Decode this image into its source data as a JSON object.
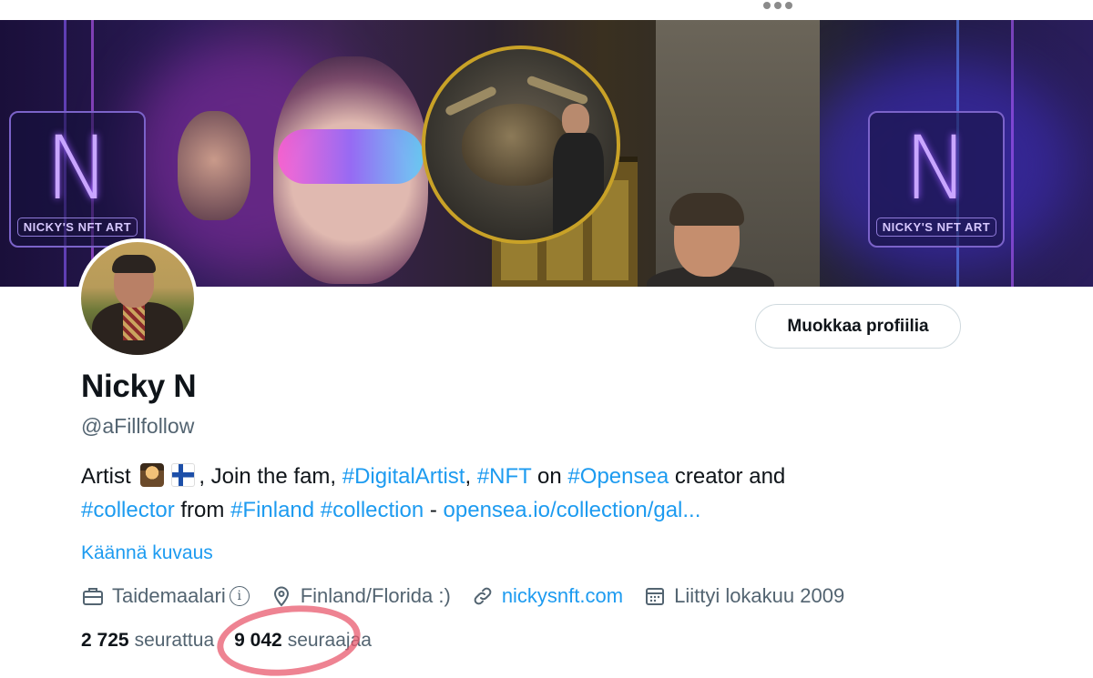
{
  "banner": {
    "logo_letter": "N",
    "logo_caption": "NICKY'S NFT ART"
  },
  "profile": {
    "name": "Nicky N",
    "handle": "@aFillfollow",
    "edit_button_label": "Muokkaa profiilia"
  },
  "bio": {
    "t1": "Artist ",
    "t2": ", Join the fam, ",
    "tag1": "#DigitalArtist",
    "t3": ", ",
    "tag2": "#NFT",
    "t4": " on ",
    "tag3": "#Opensea",
    "t5": " creator and ",
    "tag4": "#collector",
    "t6": " from ",
    "tag5": "#Finland",
    "t7": " ",
    "tag6": "#collection",
    "t8": " - ",
    "link": "opensea.io/collection/gal..."
  },
  "translate_label": "Käännä kuvaus",
  "meta": {
    "category": "Taidemaalari",
    "info_glyph": "i",
    "location": "Finland/Florida :)",
    "website": "nickysnft.com",
    "joined": "Liittyi lokakuu 2009"
  },
  "stats": {
    "following_count": "2 725",
    "following_label": "seurattua",
    "followers_count": "9 042",
    "followers_label": "seuraajaa"
  },
  "colors": {
    "accent": "#1d9bf0",
    "secondary_text": "#536471",
    "highlight_circle": "#e85a6e"
  }
}
